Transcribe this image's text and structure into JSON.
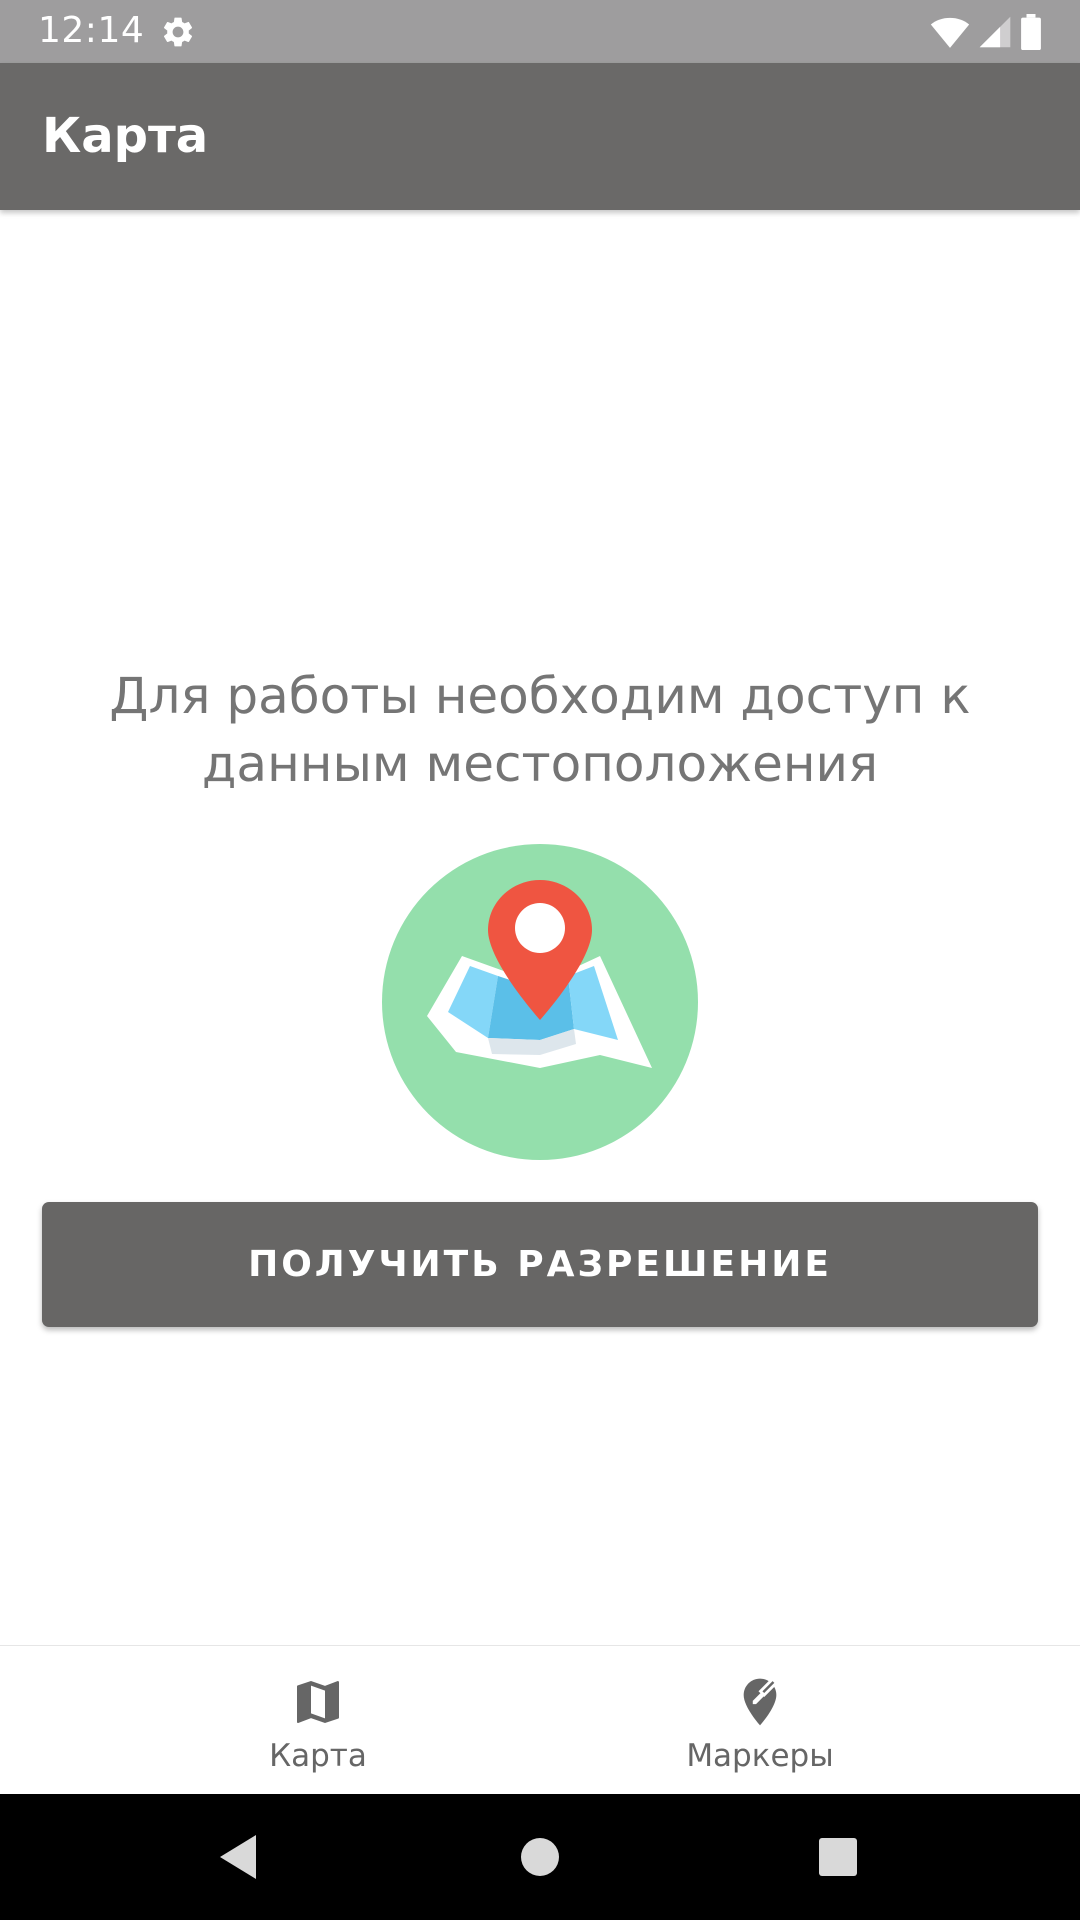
{
  "status_bar": {
    "time": "12:14",
    "icons": [
      "settings-gear-icon",
      "wifi-icon",
      "cell-signal-icon",
      "battery-icon"
    ]
  },
  "app_bar": {
    "title": "Карта"
  },
  "main": {
    "message": "Для работы необходим доступ к данным местоположения",
    "illustration": "map-location-pin-illustration",
    "permission_button_label": "ПОЛУЧИТЬ РАЗРЕШЕНИЕ"
  },
  "bottom_nav": {
    "items": [
      {
        "label": "Карта",
        "icon": "map-icon"
      },
      {
        "label": "Маркеры",
        "icon": "edit-location-icon"
      }
    ]
  },
  "system_nav": {
    "buttons": [
      "back-icon",
      "home-icon",
      "recents-icon"
    ]
  },
  "colors": {
    "status_bar": "#9e9d9e",
    "app_bar": "#6a6968",
    "button": "#676665",
    "message_text": "#757575",
    "nav_text": "#666666",
    "illustration_circle": "#94dfac",
    "pin": "#ef5541",
    "map_light": "#84d7f8",
    "map_dark": "#5bbfe8"
  }
}
